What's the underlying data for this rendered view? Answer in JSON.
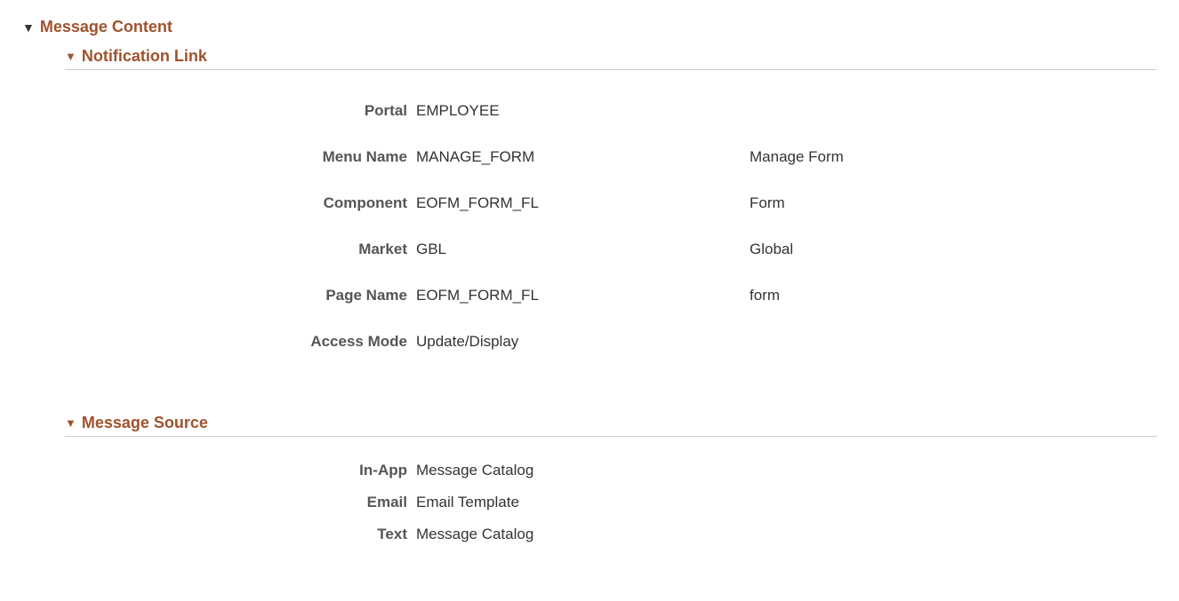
{
  "section": {
    "title": "Message Content"
  },
  "notificationLink": {
    "title": "Notification Link",
    "fields": {
      "portal": {
        "label": "Portal",
        "value": "EMPLOYEE",
        "descr": ""
      },
      "menuName": {
        "label": "Menu Name",
        "value": "MANAGE_FORM",
        "descr": "Manage Form"
      },
      "component": {
        "label": "Component",
        "value": "EOFM_FORM_FL",
        "descr": "Form"
      },
      "market": {
        "label": "Market",
        "value": "GBL",
        "descr": "Global"
      },
      "pageName": {
        "label": "Page Name",
        "value": "EOFM_FORM_FL",
        "descr": "form"
      },
      "accessMode": {
        "label": "Access Mode",
        "value": "Update/Display",
        "descr": ""
      }
    }
  },
  "messageSource": {
    "title": "Message Source",
    "fields": {
      "inapp": {
        "label": "In-App",
        "value": "Message Catalog"
      },
      "email": {
        "label": "Email",
        "value": "Email Template"
      },
      "text": {
        "label": "Text",
        "value": "Message Catalog"
      }
    }
  }
}
